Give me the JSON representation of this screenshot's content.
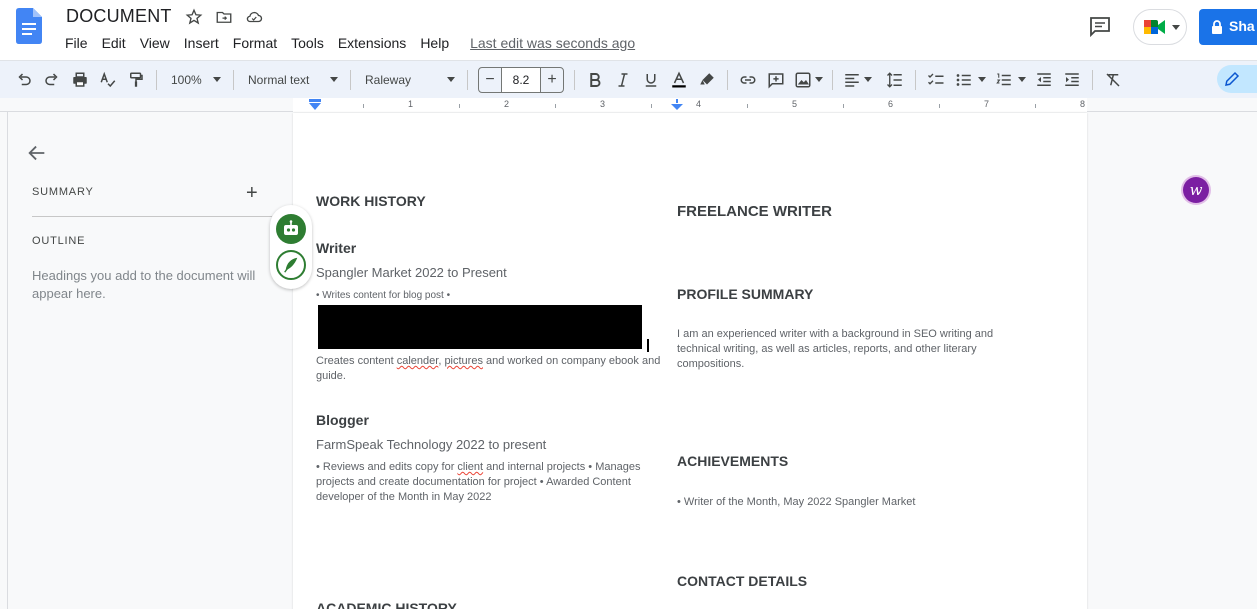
{
  "header": {
    "title": "DOCUMENT",
    "menu": [
      "File",
      "Edit",
      "View",
      "Insert",
      "Format",
      "Tools",
      "Extensions",
      "Help"
    ],
    "last_edit": "Last edit was seconds ago",
    "share_label": "Sha"
  },
  "toolbar": {
    "zoom": "100%",
    "style": "Normal text",
    "font": "Raleway",
    "font_size": "8.2",
    "minus": "−",
    "plus": "+"
  },
  "ruler": {
    "numbers": [
      "1",
      "2",
      "3",
      "4",
      "5",
      "6",
      "7",
      "8"
    ]
  },
  "sidebar": {
    "summary_label": "SUMMARY",
    "add_label": "+",
    "outline_label": "OUTLINE",
    "hint": "Headings you add to the document will appear here."
  },
  "document": {
    "work_history": "WORK HISTORY",
    "job1_title": "Writer",
    "job1_company": "Spangler Market 2022 to Present",
    "job1_bullet": "• Writes content for blog post •",
    "job1_desc_a": "Creates content ",
    "job1_desc_calender": "calender",
    "job1_desc_b": ", ",
    "job1_desc_pictures": "pictures",
    "job1_desc_c": " and worked on company ebook and guide.",
    "job2_title": "Blogger",
    "job2_company": "FarmSpeak Technology 2022 to present",
    "job2_desc_a": "• Reviews and edits copy for ",
    "job2_desc_client": "client",
    "job2_desc_b": " and internal projects • Manages projects and create documentation for project • Awarded Content developer of the Month in May 2022",
    "academic_history": "ACADEMIC HISTORY",
    "freelance": "FREELANCE WRITER",
    "profile_summary": "PROFILE SUMMARY",
    "profile_text": "I am an experienced writer with a background in SEO writing and technical writing, as well as articles, reports, and other literary compositions.",
    "achievements": "ACHIEVEMENTS",
    "achievement_item": "• Writer of the Month, May 2022 Spangler Market",
    "contact": "CONTACT DETAILS"
  },
  "badge": "w",
  "colors": {
    "accent": "#1a73e8",
    "toolbar_bg": "#edf2fa",
    "badge": "#7b1fa2",
    "addon_green": "#2e7d32"
  }
}
